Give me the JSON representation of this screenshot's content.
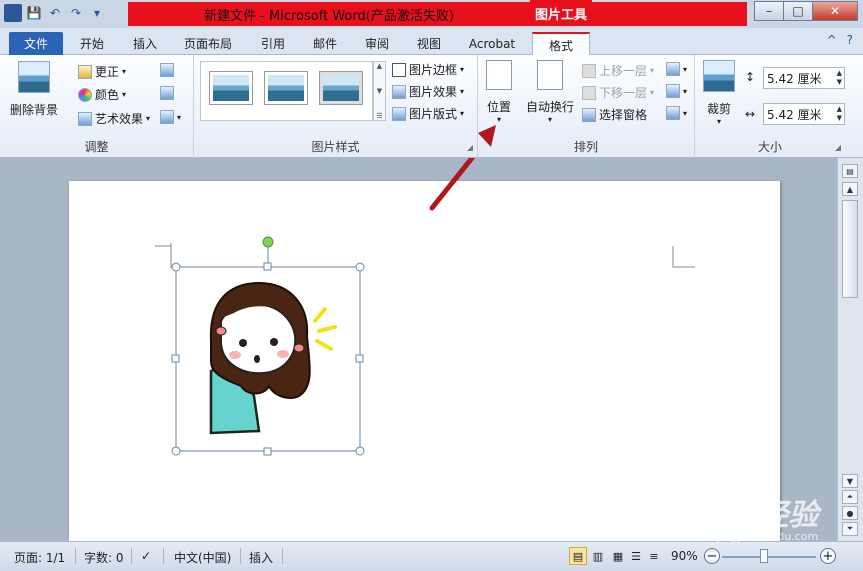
{
  "window": {
    "title": "新建文件 - Microsoft Word(产品激活失败)",
    "context_tools_title": "图片工具",
    "controls": {
      "minimize": "–",
      "maximize": "□",
      "close": "✕"
    }
  },
  "quick_access": {
    "app_icon": "W",
    "save": "💾",
    "undo": "↶",
    "redo": "↷",
    "customize": "▾"
  },
  "tabs": {
    "file": "文件",
    "home": "开始",
    "insert": "插入",
    "page_layout": "页面布局",
    "references": "引用",
    "mailings": "邮件",
    "review": "审阅",
    "view": "视图",
    "acrobat": "Acrobat",
    "format": "格式"
  },
  "ribbon_right": {
    "help": "?",
    "collapse": "^"
  },
  "groups": {
    "adjust": {
      "label": "调整",
      "remove_background": "删除背景",
      "corrections": "更正",
      "color": "颜色",
      "artistic_effects": "艺术效果"
    },
    "picture_styles": {
      "label": "图片样式",
      "border": "图片边框",
      "effects": "图片效果",
      "layout": "图片版式"
    },
    "arrange": {
      "label": "排列",
      "position": "位置",
      "wrap_text": "自动换行",
      "bring_forward": "上移一层",
      "send_backward": "下移一层",
      "selection_pane": "选择窗格"
    },
    "size": {
      "label": "大小",
      "crop": "裁剪",
      "height": "5.42 厘米",
      "width": "5.42 厘米"
    }
  },
  "status": {
    "page": "页面: 1/1",
    "words": "字数: 0",
    "language": "中文(中国)",
    "mode": "插入",
    "zoom": "90%",
    "zoom_out": "−",
    "zoom_in": "+"
  },
  "watermark": {
    "brand": "Baidu经验",
    "url": "jingyan.baidu.com"
  },
  "colors": {
    "title_red": "#e8101c",
    "accent_blue": "#2a63b8",
    "annotation_arrow": "#b0161c"
  }
}
